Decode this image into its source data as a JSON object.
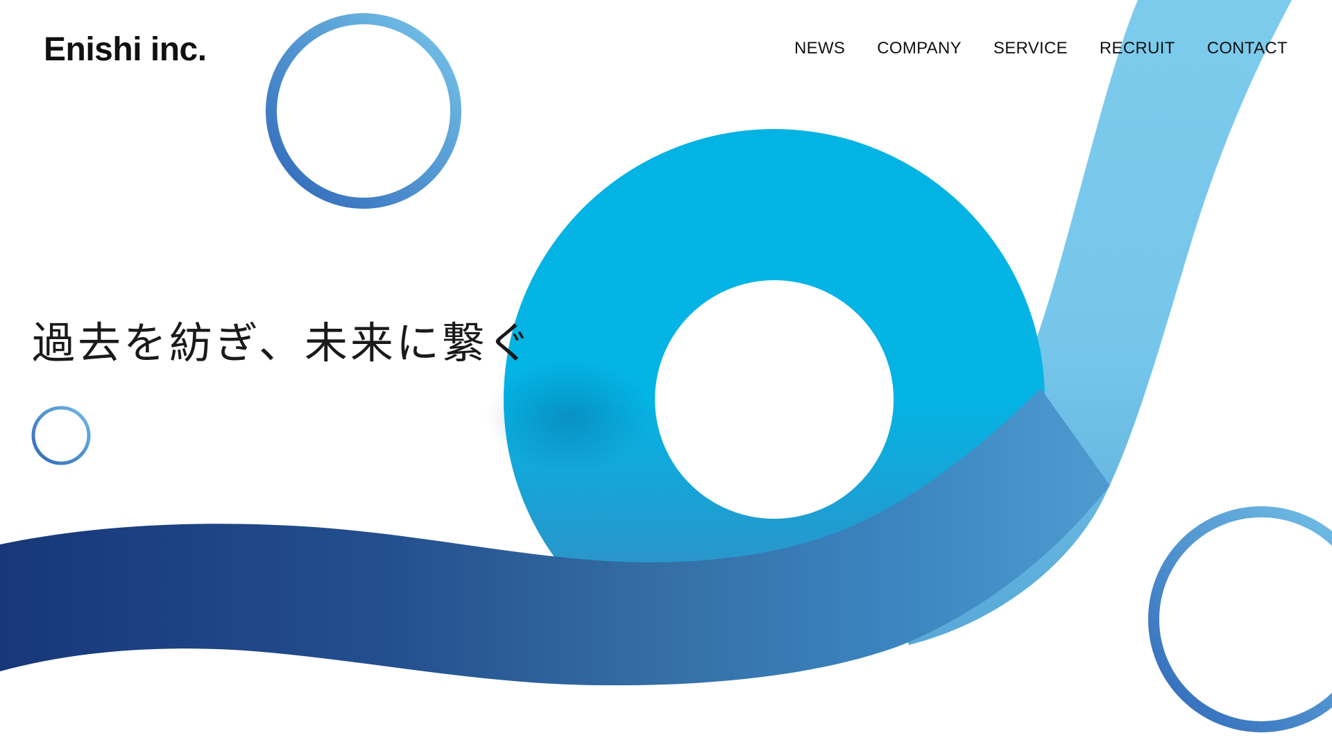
{
  "brand": {
    "logo_text": "Enishi inc."
  },
  "nav": {
    "items": [
      {
        "label": "NEWS"
      },
      {
        "label": "COMPANY"
      },
      {
        "label": "SERVICE"
      },
      {
        "label": "RECRUIT"
      },
      {
        "label": "CONTACT"
      }
    ]
  },
  "hero": {
    "tagline": "過去を紡ぎ、未来に繋ぐ"
  },
  "colors": {
    "text": "#111111",
    "ribbon_light": "#74c8ec",
    "ribbon_cyan": "#00b4e4",
    "ribbon_navy": "#17387a",
    "ring": "#3a78c4"
  }
}
